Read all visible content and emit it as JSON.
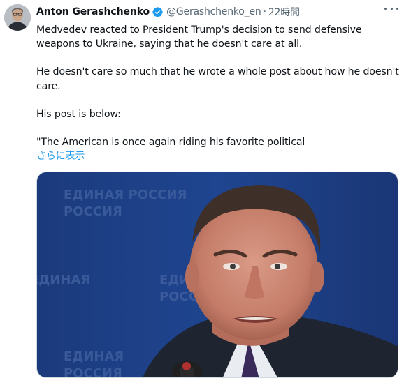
{
  "author": {
    "name": "Anton Gerashchenko",
    "handle": "@Gerashchenko_en",
    "separator": "·",
    "time": "22時間"
  },
  "tweet": {
    "paragraphs": [
      "Medvedev reacted to President Trump's decision to send defensive weapons to Ukraine, saying that he doesn't care at all.",
      "He doesn't care so much that he wrote a whole post about how he doesn't care.",
      "His post is below:",
      "\"The American is once again riding his favorite political"
    ],
    "show_more_label": "さらに表示"
  },
  "media": {
    "backdrop_text": "ЕДИНАЯ РОССИЯ"
  },
  "icons": {
    "verified": "verified-badge-icon",
    "more": "more-options-icon"
  },
  "colors": {
    "link": "#1d9bf0",
    "secondary_text": "#536471",
    "backdrop_blue": "#1d3f86"
  }
}
